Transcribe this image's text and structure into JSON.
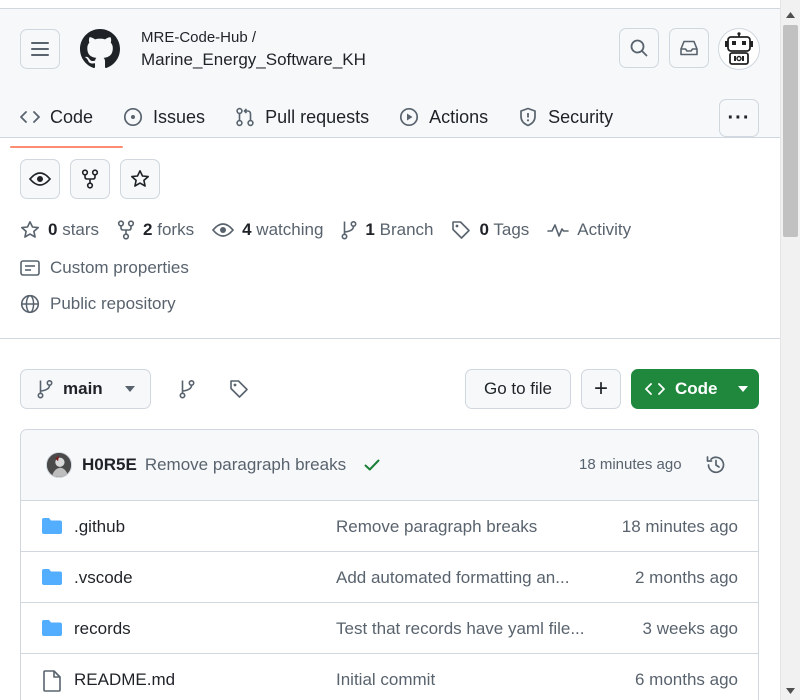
{
  "repo": {
    "owner": "MRE-Code-Hub /",
    "name": "Marine_Energy_Software_KH"
  },
  "nav": {
    "tabs": [
      {
        "label": "Code",
        "icon": "code-icon"
      },
      {
        "label": "Issues",
        "icon": "issue-opened-icon"
      },
      {
        "label": "Pull requests",
        "icon": "git-pull-request-icon"
      },
      {
        "label": "Actions",
        "icon": "play-icon"
      },
      {
        "label": "Security",
        "icon": "shield-icon"
      }
    ],
    "more": "···"
  },
  "stats": {
    "stars_count": "0",
    "stars_label": "stars",
    "forks_count": "2",
    "forks_label": "forks",
    "watching_count": "4",
    "watching_label": "watching",
    "branch_count": "1",
    "branch_label": "Branch",
    "tags_count": "0",
    "tags_label": "Tags",
    "activity_label": "Activity"
  },
  "meta": {
    "custom_properties": "Custom properties",
    "visibility": "Public repository"
  },
  "toolbar": {
    "branch": "main",
    "goto_file": "Go to file",
    "plus": "+",
    "code": "Code"
  },
  "latest_commit": {
    "author": "H0R5E",
    "message": "Remove paragraph breaks",
    "time": "18 minutes ago"
  },
  "files": [
    {
      "name": ".github",
      "type": "folder",
      "message": "Remove paragraph breaks",
      "time": "18 minutes ago"
    },
    {
      "name": ".vscode",
      "type": "folder",
      "message": "Add automated formatting an...",
      "time": "2 months ago"
    },
    {
      "name": "records",
      "type": "folder",
      "message": "Test that records have yaml file...",
      "time": "3 weeks ago"
    },
    {
      "name": "README.md",
      "type": "file",
      "message": "Initial commit",
      "time": "6 months ago"
    }
  ],
  "colors": {
    "accent_green": "#1f883d",
    "folder_blue": "#54aeff",
    "tab_underline": "#fd8c73"
  }
}
